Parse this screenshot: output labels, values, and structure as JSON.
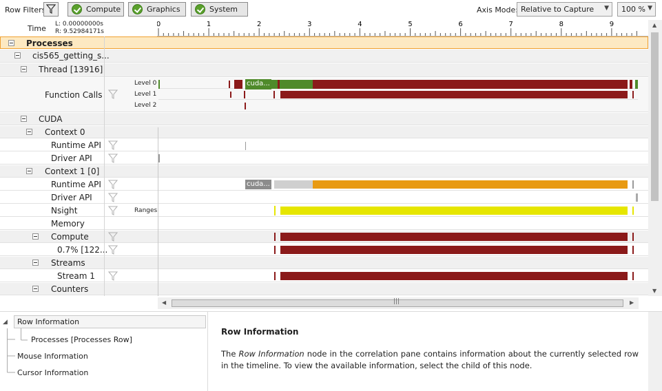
{
  "toolbar": {
    "row_filters_label": "Row Filters",
    "filter_icon": "funnel-icon",
    "categories": [
      {
        "label": "Compute",
        "icon": "check-circle-icon"
      },
      {
        "label": "Graphics",
        "icon": "check-circle-icon"
      },
      {
        "label": "System",
        "icon": "check-circle-icon"
      }
    ],
    "axis_mode_label": "Axis Mode:",
    "axis_mode_value": "Relative to Capture",
    "zoom_value": "100 %"
  },
  "ruler": {
    "time_label": "Time",
    "left_value": "L: 0.00000000s",
    "right_value": "R: 9.52984171s",
    "ticks": [
      "0",
      "1",
      "2",
      "3",
      "4",
      "5",
      "6",
      "7",
      "8",
      "9"
    ]
  },
  "rows": {
    "processes": "Processes",
    "process_name": "cis565_getting_s...",
    "thread": "Thread [13916]",
    "function_calls": "Function Calls",
    "level0": "Level 0",
    "level1": "Level 1",
    "level2": "Level 2",
    "cuda": "CUDA",
    "context0": "Context 0",
    "runtime_api": "Runtime API",
    "driver_api": "Driver API",
    "context1": "Context 1 [0]",
    "runtime_api_2": "Runtime API",
    "driver_api_2": "Driver API",
    "nsight": "Nsight",
    "ranges": "Ranges",
    "memory": "Memory",
    "compute": "Compute",
    "compute_kernel": "0.7% [122...",
    "streams": "Streams",
    "stream1": "Stream 1",
    "counters": "Counters",
    "cuda_call_label": "cuda...",
    "cuda_runtime_label": "cuda..."
  },
  "colors": {
    "selected_row": "#fde9c2",
    "bar_red": "#8b1a1a",
    "bar_green": "#4f8a2a",
    "bar_orange": "#e89a12",
    "bar_yellow": "#e6e600",
    "bar_gray": "#c8c8c8"
  },
  "tree": {
    "row_information": "Row Information",
    "processes_row": "Processes [Processes Row]",
    "mouse_information": "Mouse Information",
    "cursor_information": "Cursor Information"
  },
  "info": {
    "title": "Row Information",
    "body_prefix": "The ",
    "body_em": "Row Information",
    "body_suffix": " node in the correlation pane contains information about the currently selected row in the timeline. To view the available information, select the child of this node."
  }
}
